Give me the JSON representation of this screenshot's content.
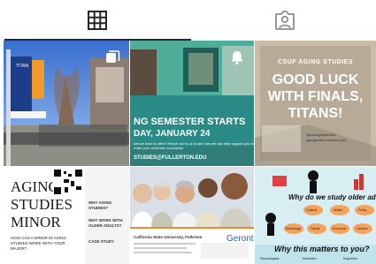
{
  "tabs": [
    {
      "name": "posts-grid",
      "icon": "grid-icon",
      "active": true
    },
    {
      "name": "tagged",
      "icon": "tagged-person-icon",
      "active": false
    }
  ],
  "posts": {
    "p2": {
      "headline": "NG SEMESTER STARTS",
      "date": "DAY, JANUARY 24",
      "small": "hat we have to offer? Reach out to us to see how we can help support you to make your semester successful.",
      "footer": "STUDIES@FULLERTON.EDU"
    },
    "p3": {
      "header": "CSUF AGING STUDIES",
      "line1": "GOOD LUCK",
      "line2": "WITH FINALS,",
      "line3": "TITANS!",
      "handle": "@csufagingstudies",
      "site": "agingstudies.fullerton.edu"
    },
    "p4": {
      "line1": "AGING",
      "line2": "STUDIES",
      "line3": "MINOR",
      "question": "HOW CAN A MINOR IN AGING STUDIES WORK WITH YOUR MAJOR?",
      "why": "WHY AGING STUDIES?",
      "work": "WHY WORK WITH OLDER ADULTS?",
      "case": "CASE STUDY"
    },
    "p5": {
      "brand": "Geront",
      "caption": "California State University, Fullerton"
    },
    "p6": {
      "question": "Why do we study older adults?",
      "tag1": "Cultural",
      "tag2": "Health",
      "tag3": "Policy",
      "tag4": "Technology",
      "tag5": "Family",
      "tag6": "Economic",
      "tag7": "Careers",
      "bottom": "Why this matters to you?",
      "c1": "Psychologists",
      "c2": "Marketers",
      "c3": "Engineers"
    }
  },
  "colors": {
    "accent": "#262626",
    "teal": "#2b8f94",
    "orange": "#f08a28"
  }
}
